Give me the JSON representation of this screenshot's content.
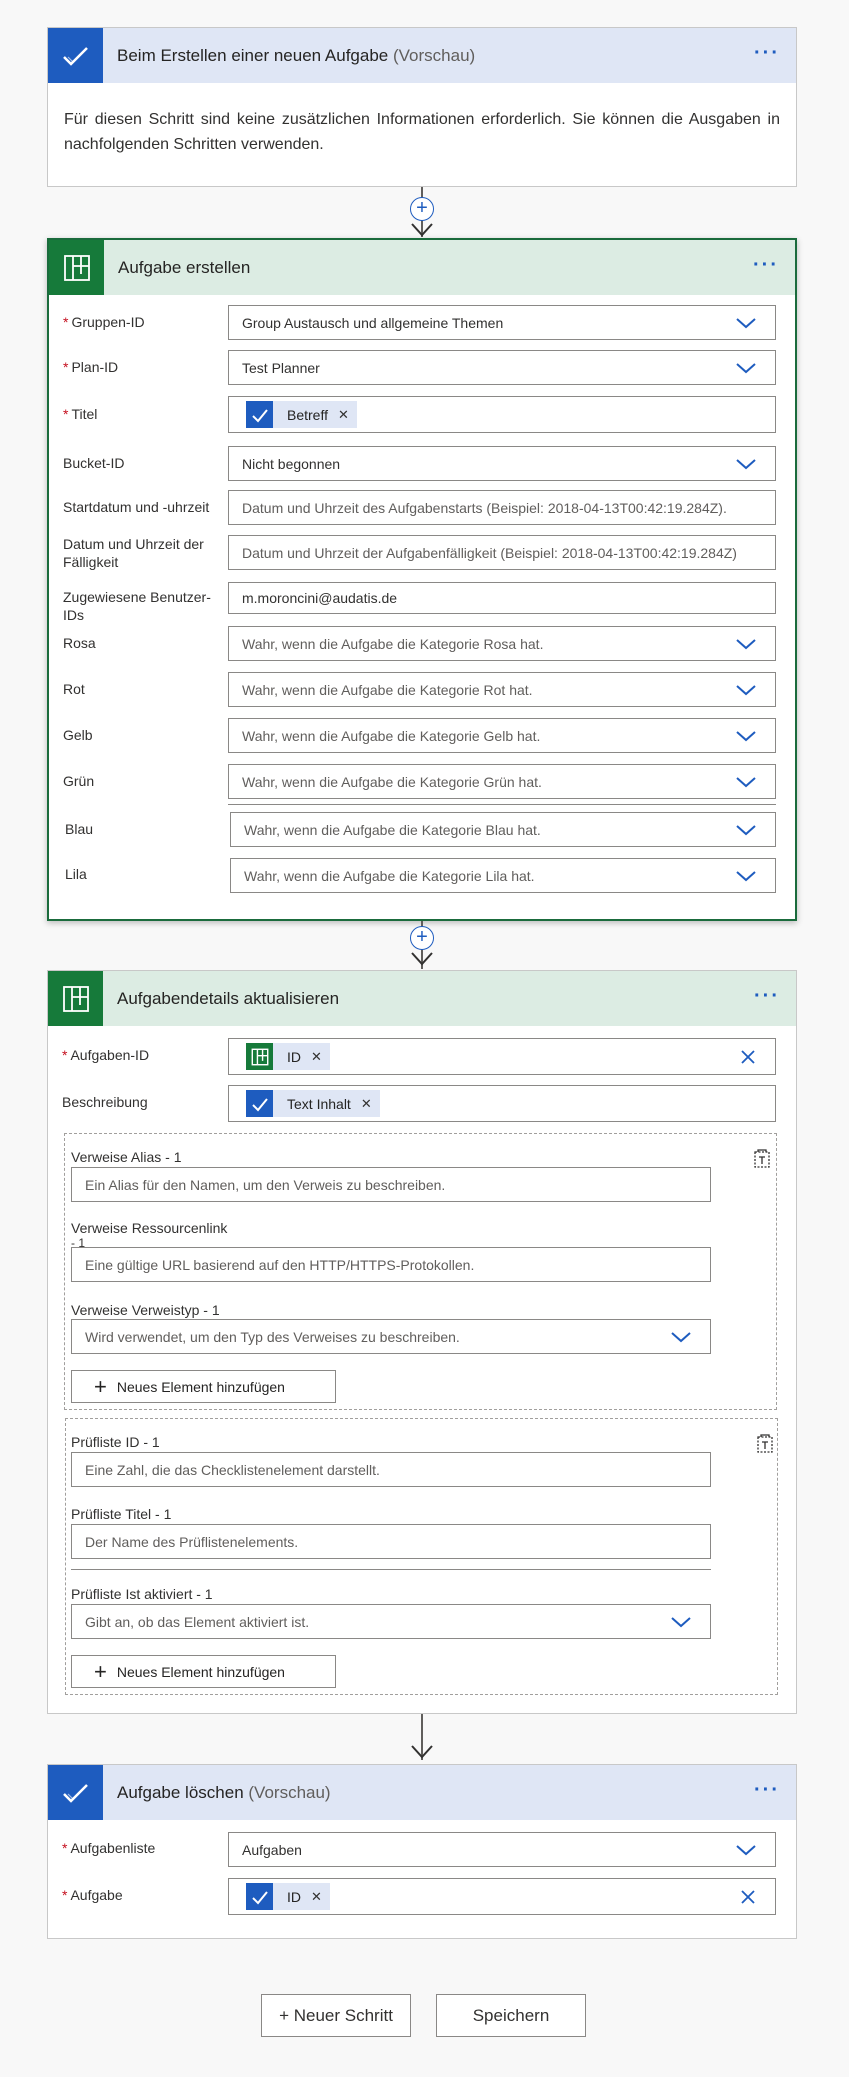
{
  "trigger": {
    "title": "Beim Erstellen einer neuen Aufgabe",
    "title_muted": "(Vorschau)",
    "message": "Für diesen Schritt sind keine zusätzlichen Informationen erforderlich. Sie können die Ausgaben in nachfolgenden Schritten verwenden."
  },
  "create": {
    "title": "Aufgabe erstellen",
    "fields": {
      "group_label": "Gruppen-ID",
      "group_value": "Group Austausch und allgemeine Themen",
      "plan_label": "Plan-ID",
      "plan_value": "Test Planner",
      "title_label": "Titel",
      "title_token": "Betreff",
      "bucket_label": "Bucket-ID",
      "bucket_value": "Nicht begonnen",
      "start_label": "Startdatum und -uhrzeit",
      "start_placeholder": "Datum und Uhrzeit des Aufgabenstarts (Beispiel: 2018-04-13T00:42:19.284Z).",
      "due_label": "Datum und Uhrzeit der Fälligkeit",
      "due_placeholder": "Datum und Uhrzeit der Aufgabenfälligkeit (Beispiel: 2018-04-13T00:42:19.284Z)",
      "assigned_label": "Zugewiesene Benutzer-IDs",
      "assigned_value": "m.moroncini@audatis.de",
      "rosa_label": "Rosa",
      "rosa_placeholder": "Wahr, wenn die Aufgabe die Kategorie Rosa hat.",
      "rot_label": "Rot",
      "rot_placeholder": "Wahr, wenn die Aufgabe die Kategorie Rot hat.",
      "gelb_label": "Gelb",
      "gelb_placeholder": "Wahr, wenn die Aufgabe die Kategorie Gelb hat.",
      "gruen_label": "Grün",
      "gruen_placeholder": "Wahr, wenn die Aufgabe die Kategorie Grün hat.",
      "blau_label": "Blau",
      "blau_placeholder": "Wahr, wenn die Aufgabe die Kategorie Blau hat.",
      "lila_label": "Lila",
      "lila_placeholder": "Wahr, wenn die Aufgabe die Kategorie Lila hat."
    }
  },
  "update": {
    "title": "Aufgabendetails aktualisieren",
    "taskid_label": "Aufgaben-ID",
    "taskid_token": "ID",
    "desc_label": "Beschreibung",
    "desc_token": "Text Inhalt",
    "ref_alias_label": "Verweise Alias - 1",
    "ref_alias_placeholder": "Ein Alias für den Namen, um den Verweis zu beschreiben.",
    "ref_link_label": "Verweise Ressourcenlink",
    "ref_link_label2": "- 1",
    "ref_link_placeholder": "Eine gültige URL basierend auf den HTTP/HTTPS-Protokollen.",
    "ref_type_label": "Verweise Verweistyp - 1",
    "ref_type_placeholder": "Wird verwendet, um den Typ des Verweises zu beschreiben.",
    "add_label": "Neues Element hinzufügen",
    "chk_id_label": "Prüfliste ID - 1",
    "chk_id_placeholder": "Eine Zahl, die das Checklistenelement darstellt.",
    "chk_title_label": "Prüfliste Titel - 1",
    "chk_title_placeholder": "Der Name des Prüflistenelements.",
    "chk_active_label": "Prüfliste Ist aktiviert - 1",
    "chk_active_placeholder": "Gibt an, ob das Element aktiviert ist."
  },
  "delete": {
    "title": "Aufgabe löschen",
    "title_muted": "(Vorschau)",
    "list_label": "Aufgabenliste",
    "list_value": "Aufgaben",
    "task_label": "Aufgabe",
    "task_token": "ID"
  },
  "footer": {
    "new_step": "+ Neuer Schritt",
    "save": "Speichern"
  },
  "colors": {
    "todo_blue": "#1e5cbf",
    "planner_green": "#167a3a",
    "required_red": "#c50f1f"
  }
}
